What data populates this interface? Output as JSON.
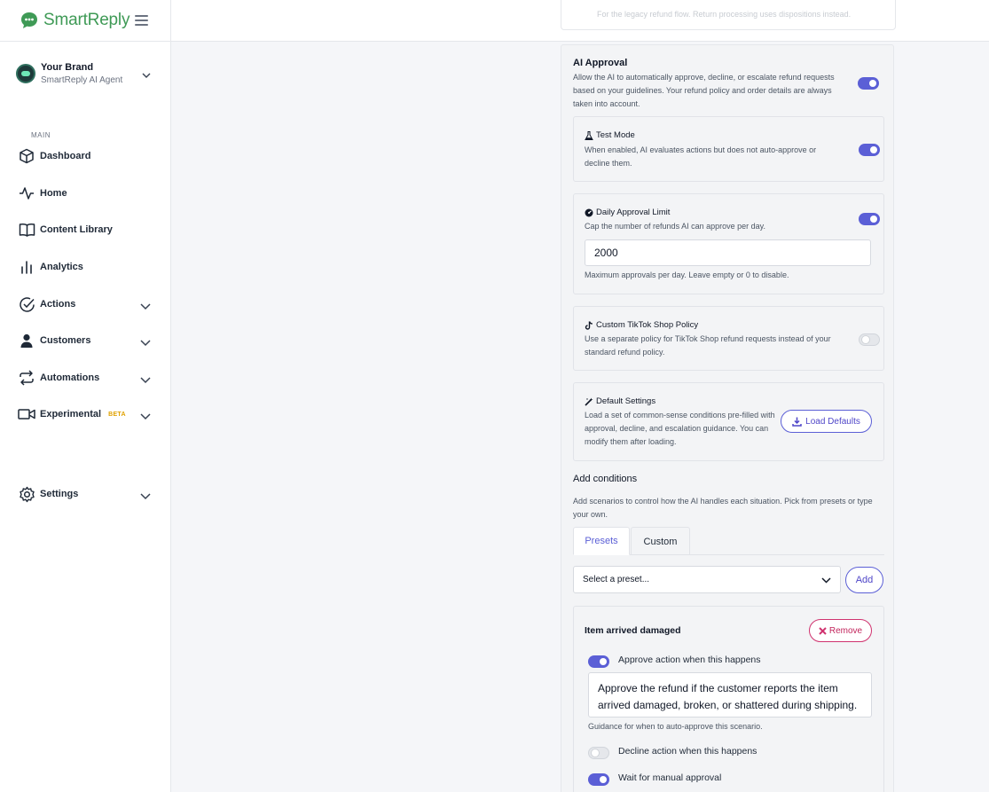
{
  "app": {
    "logo_text": "SmartReply"
  },
  "brand": {
    "name": "Your Brand",
    "subtitle": "SmartReply AI Agent"
  },
  "sidebar": {
    "section_label": "MAIN",
    "items": [
      {
        "label": "Dashboard"
      },
      {
        "label": "Home"
      },
      {
        "label": "Content Library"
      },
      {
        "label": "Analytics"
      },
      {
        "label": "Actions"
      },
      {
        "label": "Customers"
      },
      {
        "label": "Automations"
      },
      {
        "label": "Experimental",
        "badge": "BETA"
      },
      {
        "label": "Settings"
      }
    ]
  },
  "legacy": {
    "text": "For the legacy refund flow. Return processing uses dispositions instead."
  },
  "ai_approval": {
    "title": "AI Approval",
    "description": "Allow the AI to automatically approve, decline, or escalate refund requests based on your guidelines. Your refund policy and order details are always taken into account.",
    "enabled": true,
    "test_mode": {
      "title": "Test Mode",
      "description": "When enabled, AI evaluates actions but does not auto-approve or decline them.",
      "enabled": true
    },
    "daily_limit": {
      "title": "Daily Approval Limit",
      "description": "Cap the number of refunds AI can approve per day.",
      "value": "2000",
      "help": "Maximum approvals per day. Leave empty or 0 to disable.",
      "enabled": true
    },
    "tiktok": {
      "title": "Custom TikTok Shop Policy",
      "description": "Use a separate policy for TikTok Shop refund requests instead of your standard refund policy.",
      "enabled": false
    },
    "defaults": {
      "title": "Default Settings",
      "description": "Load a set of common-sense conditions pre-filled with approval, decline, and escalation guidance. You can modify them after loading.",
      "button_label": "Load Defaults"
    }
  },
  "conditions": {
    "title": "Add conditions",
    "description": "Add scenarios to control how the AI handles each situation. Pick from presets or type your own.",
    "tabs": [
      {
        "label": "Presets"
      },
      {
        "label": "Custom"
      }
    ],
    "select_placeholder": "Select a preset...",
    "add_label": "Add",
    "card": {
      "title": "Item arrived damaged",
      "remove_label": "Remove",
      "approve_label": "Approve action when this happens",
      "approve_enabled": true,
      "approve_text": "Approve the refund if the customer reports the item arrived damaged, broken, or shattered during shipping. Photo evidence is helpful but not always required.",
      "approve_help": "Guidance for when to auto-approve this scenario.",
      "decline_label": "Decline action when this happens",
      "decline_enabled": false,
      "wait_label": "Wait for manual approval",
      "wait_enabled": true
    }
  },
  "colors": {
    "accent": "#5b5fd6",
    "brand_green": "#3f9a56",
    "danger": "#c2255c"
  }
}
